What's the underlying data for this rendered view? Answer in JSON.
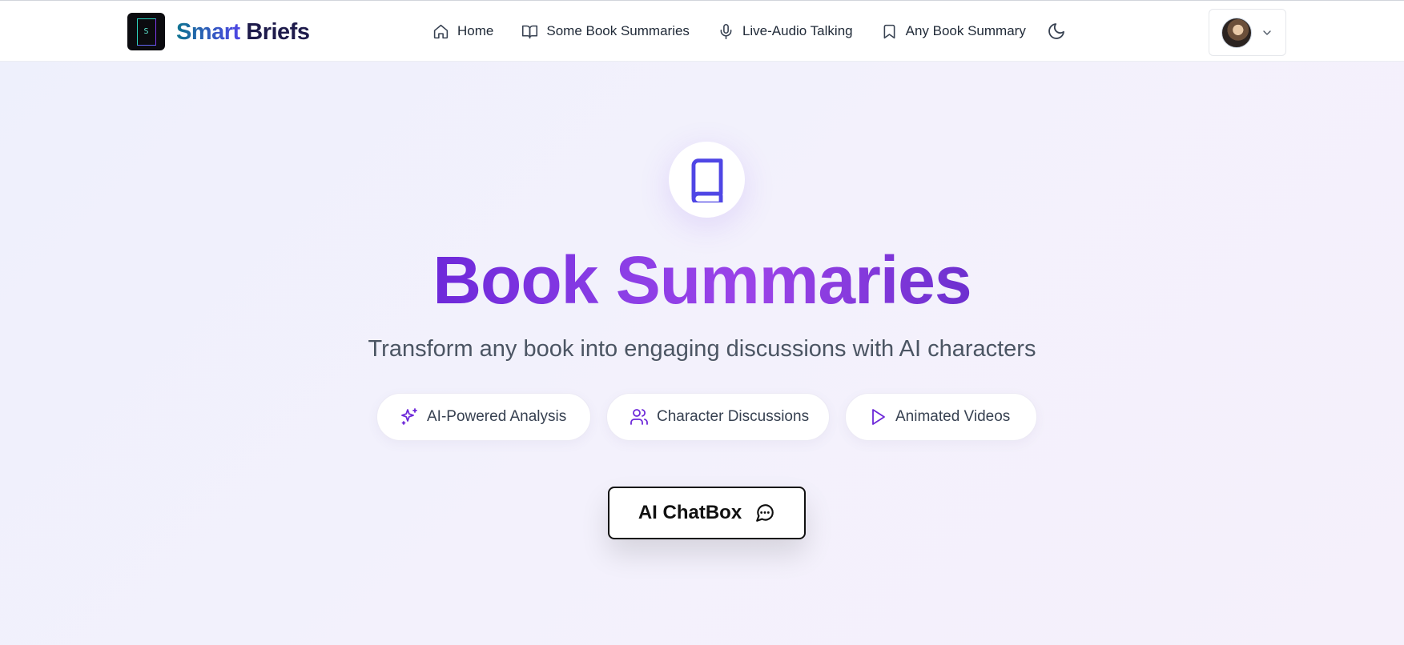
{
  "header": {
    "logo_letter": "S",
    "brand_part1": "Smart",
    "brand_part2": "Briefs",
    "nav": [
      {
        "label": "Home",
        "icon": "home-icon"
      },
      {
        "label": "Some Book Summaries",
        "icon": "book-open-icon"
      },
      {
        "label": "Live-Audio Talking",
        "icon": "microphone-icon"
      },
      {
        "label": "Any Book Summary",
        "icon": "bookmark-icon"
      }
    ],
    "theme_toggle_icon": "moon-icon",
    "user_menu_icon": "chevron-down-icon"
  },
  "hero": {
    "icon": "book-icon",
    "title": "Book Summaries",
    "subtitle": "Transform any book into engaging discussions with AI characters",
    "features": [
      {
        "label": "AI-Powered Analysis",
        "icon": "sparkles-icon"
      },
      {
        "label": "Character Discussions",
        "icon": "users-icon"
      },
      {
        "label": "Animated Videos",
        "icon": "play-icon"
      }
    ],
    "cta_label": "AI ChatBox",
    "cta_icon": "message-circle-icon"
  },
  "colors": {
    "accent": "#7c3aed",
    "icon_accent": "#4f46e5",
    "background": "#f1f0fc"
  }
}
